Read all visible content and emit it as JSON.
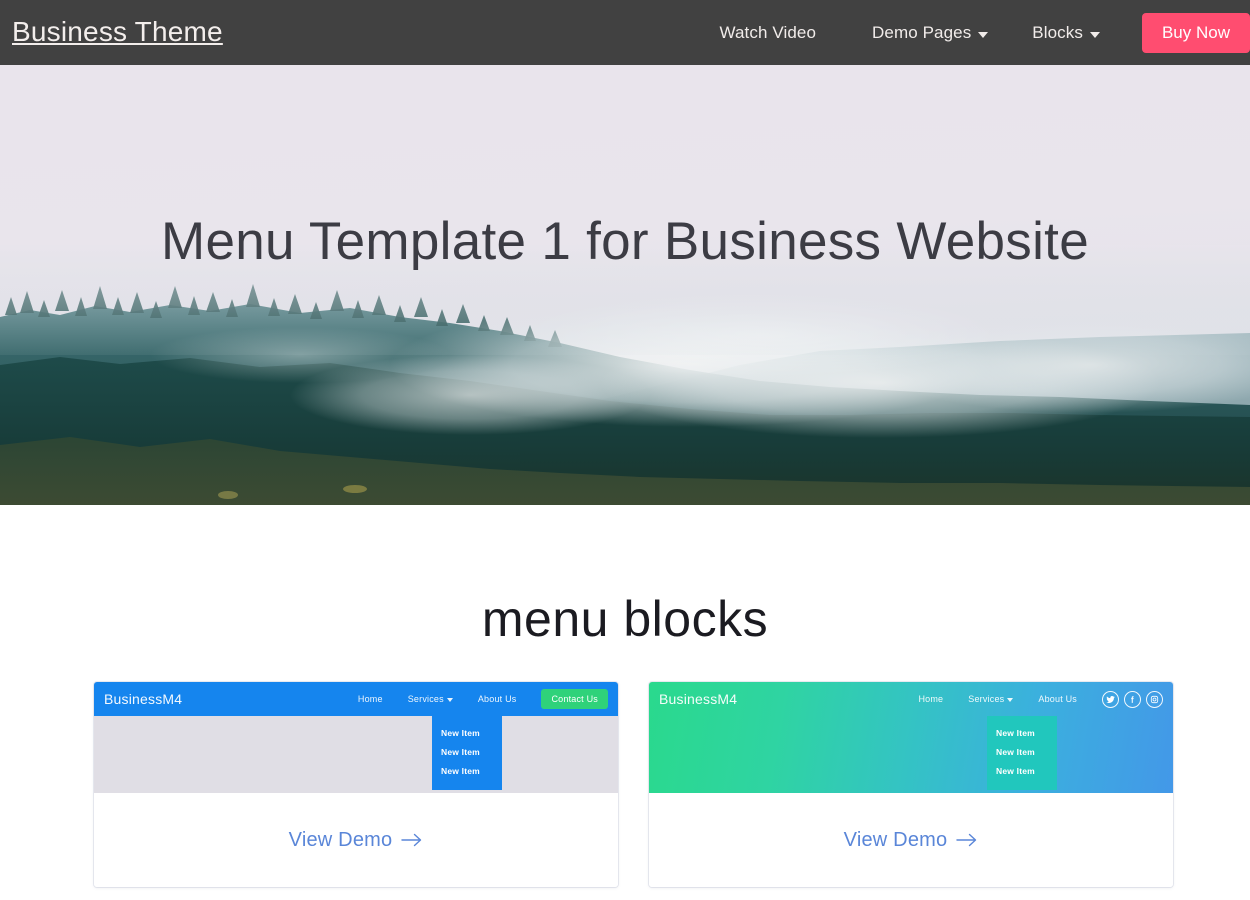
{
  "navbar": {
    "brand": "Business Theme",
    "links": [
      {
        "label": "Watch Video",
        "has_caret": false
      },
      {
        "label": "Demo Pages",
        "has_caret": true
      },
      {
        "label": "Blocks",
        "has_caret": true
      }
    ],
    "cta_label": "Buy Now",
    "background_color": "#414141",
    "cta_color": "#ff4d70"
  },
  "hero": {
    "title": "Menu Template 1 for Business Website",
    "image_description": "misty evergreen forest on a hillside under pale lavender fog",
    "title_color": "#3c3c44"
  },
  "section": {
    "title": "menu blocks"
  },
  "cards": [
    {
      "brand": "BusinessM4",
      "nav_items": [
        {
          "label": "Home",
          "has_caret": false
        },
        {
          "label": "Services",
          "has_caret": true
        },
        {
          "label": "About Us",
          "has_caret": false
        }
      ],
      "button_label": "Contact Us",
      "button_color": "#2fd27a",
      "nav_color": "#1585ee",
      "body_color": "#e0dee5",
      "dropdown_items": [
        "New Item",
        "New Item",
        "New Item"
      ],
      "dropdown_color": "#1585ee",
      "link_label": "View Demo",
      "link_arrow": "→",
      "link_color": "#5a86d8"
    },
    {
      "brand": "BusinessM4",
      "nav_items": [
        {
          "label": "Home",
          "has_caret": false
        },
        {
          "label": "Services",
          "has_caret": true
        },
        {
          "label": "About Us",
          "has_caret": false
        }
      ],
      "social_icons": [
        "twitter-icon",
        "facebook-icon",
        "instagram-icon"
      ],
      "gradient_from": "#2ad98d",
      "gradient_to": "#4398e8",
      "dropdown_items": [
        "New Item",
        "New Item",
        "New Item"
      ],
      "dropdown_color": "#21c7bd",
      "link_label": "View Demo",
      "link_arrow": "→",
      "link_color": "#5a86d8"
    }
  ]
}
